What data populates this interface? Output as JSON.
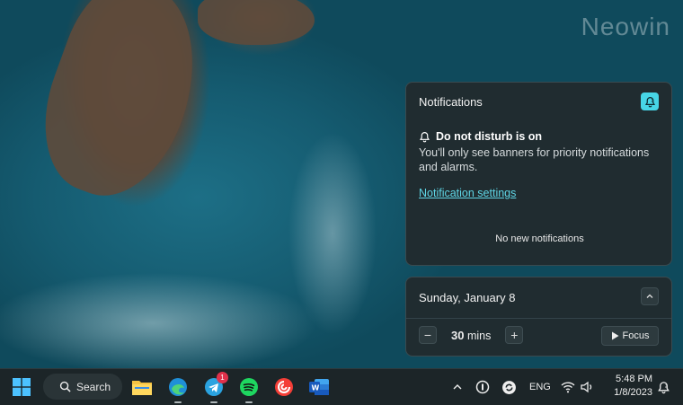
{
  "watermark": "Neowin",
  "notifications": {
    "title": "Notifications",
    "dnd_heading": "Do not disturb is on",
    "dnd_description": "You'll only see banners for priority notifications and alarms.",
    "settings_link": "Notification settings",
    "empty_text": "No new notifications"
  },
  "calendar": {
    "date": "Sunday, January 8",
    "focus_minutes": "30",
    "minutes_unit": "mins",
    "focus_label": "Focus"
  },
  "taskbar": {
    "search_label": "Search",
    "telegram_badge": "1",
    "language": "ENG",
    "time": "5:48 PM",
    "date": "1/8/2023"
  },
  "colors": {
    "accent": "#47d6e6",
    "link": "#5fd6e6",
    "panel_bg": "#202c30",
    "taskbar_bg": "#1c2528"
  },
  "icons": [
    "start-icon",
    "search-icon",
    "file-explorer-icon",
    "edge-icon",
    "telegram-icon",
    "spotify-icon",
    "pocket-casts-icon",
    "word-icon",
    "chevron-up-icon",
    "password-manager-icon",
    "sync-icon",
    "wifi-icon",
    "volume-icon",
    "dnd-bell-icon"
  ]
}
